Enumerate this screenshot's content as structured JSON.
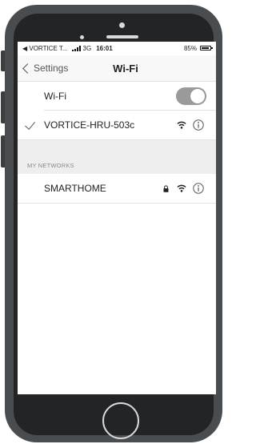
{
  "status_bar": {
    "back_app": "◀ VORTICE T...",
    "network": "3G",
    "time": "16:01",
    "battery": "85%"
  },
  "nav": {
    "back_label": "Settings",
    "title": "Wi-Fi"
  },
  "wifi_toggle": {
    "label": "Wi-Fi",
    "on": true
  },
  "connected_network": {
    "name": "VORTICE-HRU-503c",
    "secured": false
  },
  "section": {
    "header": "MY NETWORKS"
  },
  "networks": [
    {
      "name": "SMARTHOME",
      "secured": true
    }
  ],
  "icons": {
    "wifi": "wifi-signal-icon",
    "info": "info-icon",
    "lock": "lock-icon",
    "check": "checkmark-icon",
    "back": "chevron-left-icon"
  },
  "colors": {
    "phone_body": "#4a4d50",
    "toggle": "#9a9a9a",
    "section_bg": "#eeeeee"
  }
}
